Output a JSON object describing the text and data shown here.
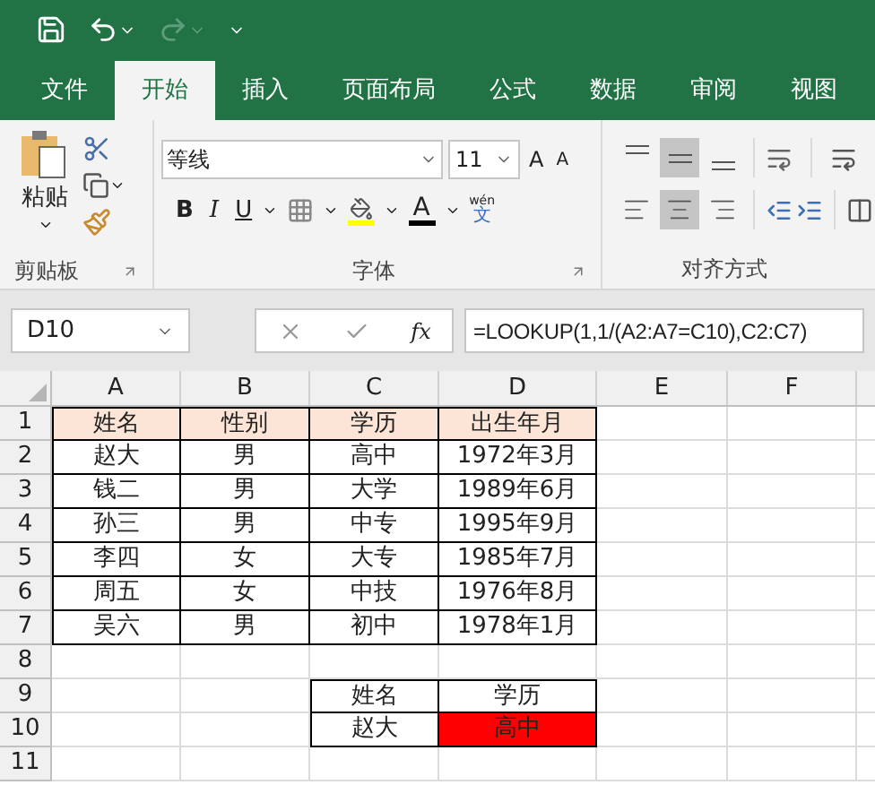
{
  "tabs": [
    {
      "label": "文件",
      "selected": false
    },
    {
      "label": "开始",
      "selected": true
    },
    {
      "label": "插入",
      "selected": false
    },
    {
      "label": "页面布局",
      "selected": false
    },
    {
      "label": "公式",
      "selected": false
    },
    {
      "label": "数据",
      "selected": false
    },
    {
      "label": "审阅",
      "selected": false
    },
    {
      "label": "视图",
      "selected": false
    }
  ],
  "clipboard": {
    "paste_label": "粘贴",
    "group_label": "剪贴板"
  },
  "font": {
    "font_name": "等线",
    "font_size": "11",
    "grow_label": "A",
    "shrink_label": "A",
    "bold_label": "B",
    "italic_label": "I",
    "underline_label": "U",
    "font_color_label": "A",
    "phonetic_top": "wén",
    "phonetic_bottom": "文",
    "group_label": "字体"
  },
  "alignment": {
    "group_label": "对齐方式",
    "vertical": [
      {
        "kind": "top",
        "selected": false
      },
      {
        "kind": "middle",
        "selected": true
      },
      {
        "kind": "bottom",
        "selected": false
      }
    ],
    "horizontal": [
      {
        "kind": "left",
        "selected": false
      },
      {
        "kind": "center",
        "selected": true
      },
      {
        "kind": "right",
        "selected": false
      }
    ]
  },
  "name_box": "D10",
  "fx_label": "fx",
  "formula": "=LOOKUP(1,1/(A2:A7=C10),C2:C7)",
  "columns": [
    "A",
    "B",
    "C",
    "D",
    "E",
    "F"
  ],
  "rows": [
    {
      "header": "1",
      "cells": [
        {
          "text": "姓名",
          "bordered": true,
          "color": "#fce4d6"
        },
        {
          "text": "性别",
          "bordered": true,
          "color": "#fce4d6"
        },
        {
          "text": "学历",
          "bordered": true,
          "color": "#fce4d6"
        },
        {
          "text": "出生年月",
          "bordered": true,
          "color": "#fce4d6"
        }
      ]
    },
    {
      "header": "2",
      "cells": [
        {
          "text": "赵大",
          "bordered": true
        },
        {
          "text": "男",
          "bordered": true
        },
        {
          "text": "高中",
          "bordered": true
        },
        {
          "text": "1972年3月",
          "bordered": true
        }
      ]
    },
    {
      "header": "3",
      "cells": [
        {
          "text": "钱二",
          "bordered": true
        },
        {
          "text": "男",
          "bordered": true
        },
        {
          "text": "大学",
          "bordered": true
        },
        {
          "text": "1989年6月",
          "bordered": true
        }
      ]
    },
    {
      "header": "4",
      "cells": [
        {
          "text": "孙三",
          "bordered": true
        },
        {
          "text": "男",
          "bordered": true
        },
        {
          "text": "中专",
          "bordered": true
        },
        {
          "text": "1995年9月",
          "bordered": true
        }
      ]
    },
    {
      "header": "5",
      "cells": [
        {
          "text": "李四",
          "bordered": true
        },
        {
          "text": "女",
          "bordered": true
        },
        {
          "text": "大专",
          "bordered": true
        },
        {
          "text": "1985年7月",
          "bordered": true
        }
      ]
    },
    {
      "header": "6",
      "cells": [
        {
          "text": "周五",
          "bordered": true
        },
        {
          "text": "女",
          "bordered": true
        },
        {
          "text": "中技",
          "bordered": true
        },
        {
          "text": "1976年8月",
          "bordered": true
        }
      ]
    },
    {
      "header": "7",
      "cells": [
        {
          "text": "吴六",
          "bordered": true
        },
        {
          "text": "男",
          "bordered": true
        },
        {
          "text": "初中",
          "bordered": true
        },
        {
          "text": "1978年1月",
          "bordered": true
        }
      ]
    },
    {
      "header": "8",
      "cells": []
    },
    {
      "header": "9",
      "cells": [
        null,
        null,
        {
          "text": "姓名",
          "bordered": true
        },
        {
          "text": "学历",
          "bordered": true
        }
      ]
    },
    {
      "header": "10",
      "cells": [
        null,
        null,
        {
          "text": "赵大",
          "bordered": true
        },
        {
          "text": "高中",
          "bordered": true,
          "color": "#ff0000"
        }
      ]
    },
    {
      "header": "11",
      "cells": []
    }
  ]
}
